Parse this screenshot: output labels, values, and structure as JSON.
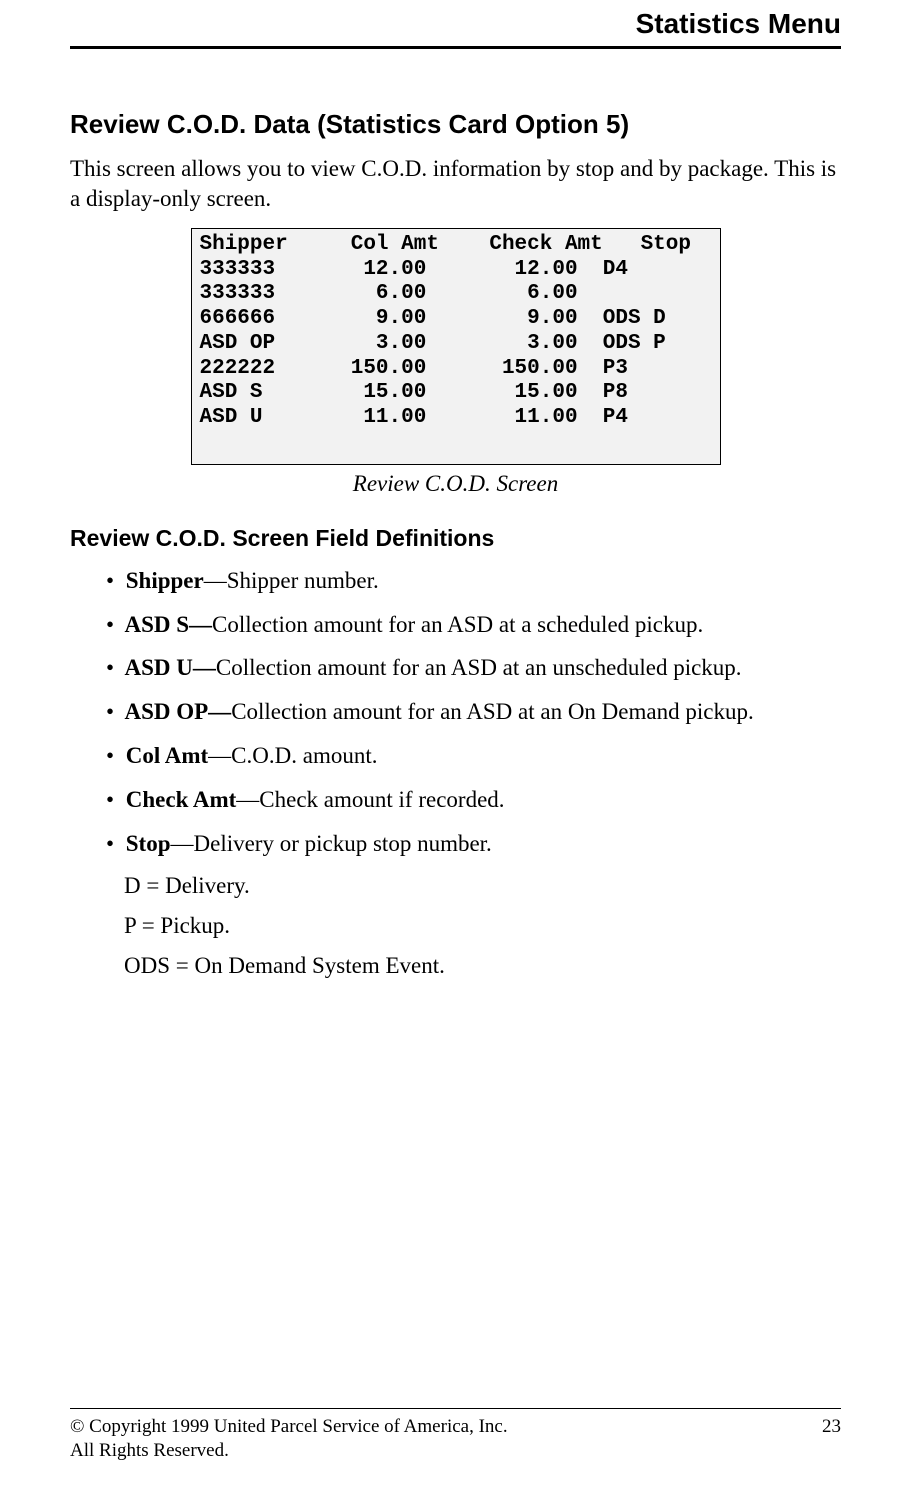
{
  "header": {
    "title": "Statistics Menu"
  },
  "h1": "Review C.O.D. Data (Statistics Card Option 5)",
  "intro": "This screen allows you to view C.O.D. information by stop and by package. This is a display-only screen.",
  "screen": {
    "headers": {
      "shipper": "Shipper",
      "col_amt": "Col Amt",
      "check_amt": "Check Amt",
      "stop": "Stop"
    },
    "rows": [
      {
        "shipper": "333333",
        "col_amt": "12.00",
        "check_amt": "12.00",
        "stop": "D4"
      },
      {
        "shipper": "333333",
        "col_amt": "6.00",
        "check_amt": "6.00",
        "stop": ""
      },
      {
        "shipper": "666666",
        "col_amt": "9.00",
        "check_amt": "9.00",
        "stop": "ODS D"
      },
      {
        "shipper": "ASD OP",
        "col_amt": "3.00",
        "check_amt": "3.00",
        "stop": "ODS P"
      },
      {
        "shipper": "222222",
        "col_amt": "150.00",
        "check_amt": "150.00",
        "stop": "P3"
      },
      {
        "shipper": "ASD S",
        "col_amt": "15.00",
        "check_amt": "15.00",
        "stop": "P8"
      },
      {
        "shipper": "ASD U",
        "col_amt": "11.00",
        "check_amt": "11.00",
        "stop": "P4"
      }
    ],
    "caption": "Review C.O.D. Screen"
  },
  "defs_heading": "Review C.O.D. Screen Field Definitions",
  "defs": [
    {
      "term": "Shipper",
      "sep": "—",
      "desc": "Shipper number."
    },
    {
      "term": "ASD S—",
      "sep": "",
      "desc": "Collection amount for an ASD at a scheduled pickup."
    },
    {
      "term": "ASD U—",
      "sep": "",
      "desc": "Collection amount for an ASD at an unscheduled pickup."
    },
    {
      "term": "ASD OP—",
      "sep": "",
      "desc": "Collection amount for an ASD at an On Demand pickup."
    },
    {
      "term": "Col Amt",
      "sep": "—",
      "desc": "C.O.D. amount."
    },
    {
      "term": "Check Amt",
      "sep": "—",
      "desc": "Check amount if recorded."
    },
    {
      "term": "Stop",
      "sep": "—",
      "desc": "Delivery or pickup stop number."
    }
  ],
  "stop_sub": [
    "D = Delivery.",
    "P = Pickup.",
    "ODS = On Demand System Event."
  ],
  "footer": {
    "copyright": "© Copyright 1999 United Parcel Service of America, Inc.",
    "rights": "All Rights Reserved.",
    "page": "23"
  }
}
